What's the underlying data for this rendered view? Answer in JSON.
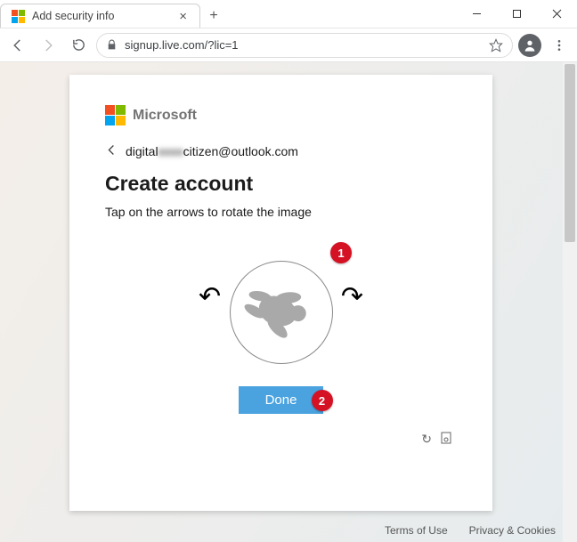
{
  "window": {
    "tab_title": "Add security info",
    "url": "signup.live.com/?lic=1"
  },
  "page": {
    "brand": "Microsoft",
    "email_prefix": "digital",
    "email_blur": "xxxx",
    "email_suffix": "citizen@outlook.com",
    "heading": "Create account",
    "instruction": "Tap on the arrows to rotate the image",
    "done_label": "Done",
    "callouts": {
      "one": "1",
      "two": "2"
    }
  },
  "footer": {
    "terms": "Terms of Use",
    "privacy": "Privacy & Cookies"
  }
}
